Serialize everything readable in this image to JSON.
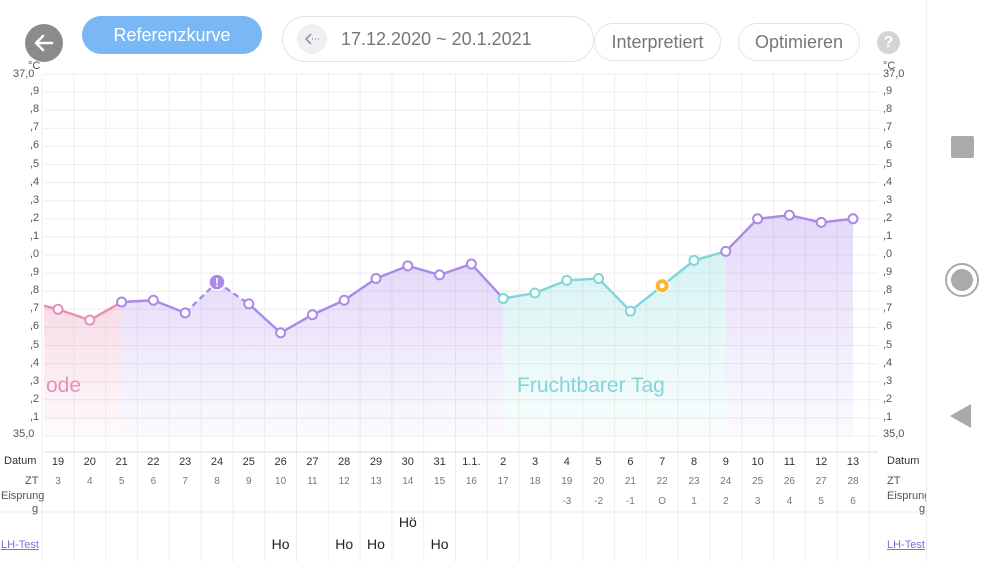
{
  "header": {
    "reference_curve_label": "Referenzkurve",
    "date_range": "17.12.2020 ~ 20.1.2021",
    "interpreted_label": "Interpretiert",
    "optimize_label": "Optimieren",
    "help_label": "?"
  },
  "y_axis": {
    "unit": "°C",
    "top_label": "37,0",
    "bottom_label": "35,0",
    "tick_labels": [
      ",9",
      ",8",
      ",7",
      ",6",
      ",5",
      ",4",
      ",3",
      ",2",
      ",1",
      ",0",
      ",9",
      ",8",
      ",7",
      ",6",
      ",5",
      ",4",
      ",3",
      ",2",
      ",1"
    ]
  },
  "rows": {
    "date_label": "Datum",
    "cycle_day_label": "ZT",
    "ovulation_label": "Eisprung",
    "ovulation_label_wrap": "g",
    "lh_label": "LH-Test"
  },
  "phase_labels": {
    "period": "ode",
    "fertile": "Fruchtbarer Tag"
  },
  "chart_data": {
    "type": "line",
    "ylabel": "°C",
    "ylim": [
      35.0,
      37.0
    ],
    "categories": [
      "19",
      "20",
      "21",
      "22",
      "23",
      "24",
      "25",
      "26",
      "27",
      "28",
      "29",
      "30",
      "31",
      "1.1.",
      "2",
      "3",
      "4",
      "5",
      "6",
      "7",
      "8",
      "9",
      "10",
      "11",
      "12",
      "13"
    ],
    "cycle_days": [
      "3",
      "4",
      "5",
      "6",
      "7",
      "8",
      "9",
      "10",
      "11",
      "12",
      "13",
      "14",
      "15",
      "16",
      "17",
      "18",
      "19",
      "20",
      "21",
      "22",
      "23",
      "24",
      "25",
      "26",
      "27",
      "28"
    ],
    "ovulation_offsets": [
      "",
      "",
      "",
      "",
      "",
      "",
      "",
      "",
      "",
      "",
      "",
      "",
      "",
      "",
      "",
      "",
      "-3",
      "-2",
      "-1",
      "O",
      "1",
      "2",
      "3",
      "4",
      "5",
      "6"
    ],
    "series": [
      {
        "values": [
          35.7,
          35.64,
          35.74,
          35.75,
          35.68,
          35.85,
          35.73,
          35.57,
          35.67,
          35.75,
          35.87,
          35.94,
          35.89,
          35.95,
          35.76,
          35.79,
          35.86,
          35.87,
          35.69,
          35.83,
          35.97,
          36.02,
          36.2,
          36.22,
          36.18,
          36.2
        ]
      }
    ],
    "segments": [
      {
        "phase": "period",
        "from": 0,
        "to": 2,
        "color": "#e88fb5"
      },
      {
        "phase": "luteal",
        "from": 2,
        "to": 14,
        "color": "#a98aeb"
      },
      {
        "phase": "fertile",
        "from": 14,
        "to": 21,
        "color": "#7fd6d8"
      },
      {
        "phase": "post",
        "from": 21,
        "to": 25,
        "color": "#a98aeb"
      }
    ],
    "markers": [
      {
        "index": 5,
        "type": "warning"
      },
      {
        "index": 19,
        "type": "ovulation"
      }
    ],
    "lh_tests": [
      {
        "index": 7,
        "label": "Ho"
      },
      {
        "index": 9,
        "label": "Ho"
      },
      {
        "index": 10,
        "label": "Ho"
      },
      {
        "index": 11,
        "label": "Hö"
      },
      {
        "index": 12,
        "label": "Ho"
      }
    ],
    "colors": {
      "period": "#e88fb5",
      "luteal": "#a98aeb",
      "fertile": "#7fd6d8",
      "ovulation": "#f7b733",
      "warning": "#a98aeb"
    }
  }
}
